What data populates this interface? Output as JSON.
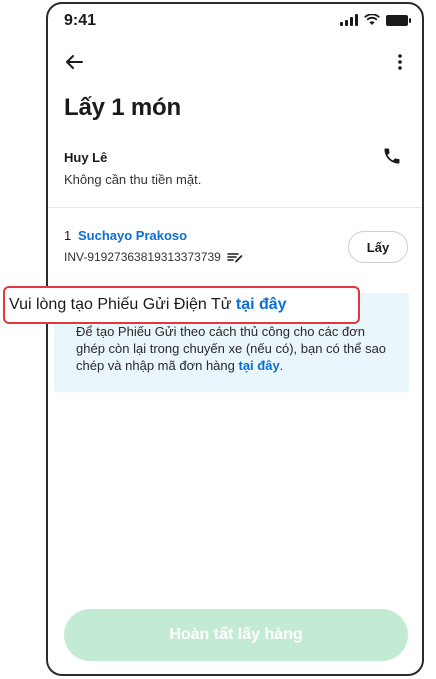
{
  "status_bar": {
    "time": "9:41"
  },
  "header": {
    "title": "Lấy 1 món"
  },
  "customer": {
    "name": "Huy Lê",
    "note": "Không cần thu tiền mặt."
  },
  "order": {
    "index": "1",
    "name": "Suchayo Prakoso",
    "code": "INV-91927363819313373739",
    "pick_label": "Lấy"
  },
  "info": {
    "line_rest": "Để tạo Phiếu Gửi theo cách thủ công cho các đơn ghép còn lại trong chuyến xe (nếu có), bạn có thể sao chép và nhập mã đơn hàng ",
    "link_end": "tại đây",
    "period": "."
  },
  "highlight": {
    "text": "Vui lòng tạo Phiếu Gửi Điện Tử ",
    "link": "tại đây"
  },
  "footer": {
    "finish_label": "Hoàn tất lấy hàng"
  },
  "colors": {
    "link": "#0a6fd6",
    "info_bg": "#e9f6fb",
    "finish_bg": "#c3ead3",
    "highlight_border": "#e0393c"
  },
  "icons": [
    "back-arrow-icon",
    "more-vert-icon",
    "phone-icon",
    "copy-icon",
    "signal-icon",
    "wifi-icon",
    "battery-icon"
  ]
}
